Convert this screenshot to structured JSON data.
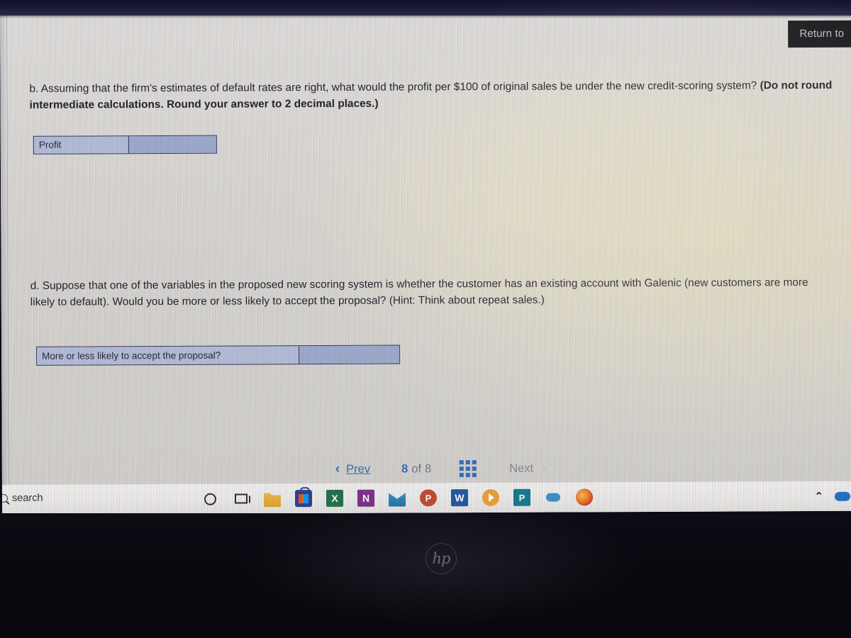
{
  "overlay": {
    "return_label": "Return to"
  },
  "questions": [
    {
      "id": "b",
      "plain_1": "b. Assuming that the firm's estimates of default rates are right, what would the profit per $100 of original sales be under the new credit-scoring system? ",
      "bold_1": "(Do not round intermediate calculations. Round your answer to 2 decimal places.)"
    },
    {
      "id": "d",
      "plain_1": "d. Suppose that one of the variables in the proposed new scoring system is whether the customer has an existing account with Galenic (new customers are more likely to default). Would you be more or less likely to accept the proposal? (Hint: Think about repeat sales.)"
    }
  ],
  "answer_tables": [
    {
      "name": "profit",
      "label": "Profit",
      "value": "",
      "placeholder": ""
    },
    {
      "name": "likely",
      "label": "More or less likely to accept the proposal?",
      "value": "",
      "placeholder": ""
    }
  ],
  "pagination": {
    "prev_label": "Prev",
    "next_label": "Next",
    "current_page": "8",
    "of_label": "of",
    "total_pages": "8",
    "grid_icon": "grid-menu-icon",
    "prev_chevron": "‹",
    "next_chevron": "›"
  },
  "taskbar": {
    "search_text": "search",
    "search_icon": "search-icon",
    "cortana_icon": "cortana-circle-icon",
    "taskview_icon": "task-view-icon",
    "apps": [
      {
        "name": "file-explorer",
        "glyph": ""
      },
      {
        "name": "microsoft-store",
        "glyph": ""
      },
      {
        "name": "excel",
        "glyph": "X"
      },
      {
        "name": "onenote",
        "glyph": "N"
      },
      {
        "name": "mail",
        "glyph": ""
      },
      {
        "name": "powerpoint",
        "glyph": "P"
      },
      {
        "name": "word",
        "glyph": "W"
      },
      {
        "name": "media-player",
        "glyph": ""
      },
      {
        "name": "publisher",
        "glyph": "P"
      },
      {
        "name": "onedrive-cloud",
        "glyph": ""
      },
      {
        "name": "firefox",
        "glyph": ""
      }
    ],
    "tray": {
      "chevron": "⌃",
      "cloud_icon": "cloud-icon"
    }
  },
  "device": {
    "brand_logo": "hp"
  },
  "colors": {
    "link_blue": "#2f6bb3",
    "input_fill": "#9facd0",
    "input_border": "#2c3150",
    "page_bg": "#dedbd7",
    "taskbar_bg": "#efeeec",
    "bezel": "#0a0910"
  }
}
